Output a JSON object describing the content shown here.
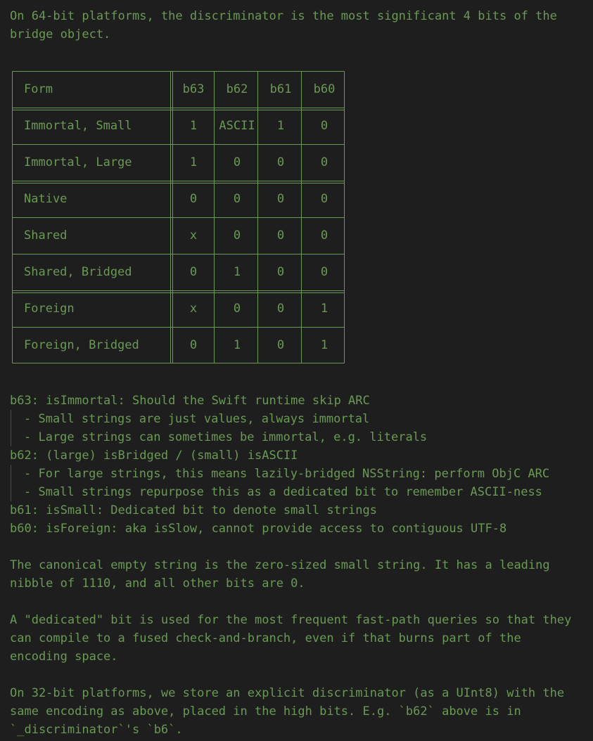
{
  "intro": {
    "line1": "On 64-bit platforms, the discriminator is the most significant 4 bits of the",
    "line2": "bridge object."
  },
  "table": {
    "headers": [
      "Form",
      "b63",
      "b62",
      "b61",
      "b60"
    ],
    "rows": [
      {
        "form": "Immortal, Small",
        "b63": "1",
        "b62": "ASCII",
        "b61": "1",
        "b60": "0"
      },
      {
        "form": "Immortal, Large",
        "b63": "1",
        "b62": "0",
        "b61": "0",
        "b60": "0"
      },
      {
        "form": "Native",
        "b63": "0",
        "b62": "0",
        "b61": "0",
        "b60": "0"
      },
      {
        "form": "Shared",
        "b63": "x",
        "b62": "0",
        "b61": "0",
        "b60": "0"
      },
      {
        "form": "Shared, Bridged",
        "b63": "0",
        "b62": "1",
        "b61": "0",
        "b60": "0"
      },
      {
        "form": "Foreign",
        "b63": "x",
        "b62": "0",
        "b61": "0",
        "b60": "1"
      },
      {
        "form": "Foreign, Bridged",
        "b63": "0",
        "b62": "1",
        "b61": "0",
        "b60": "1"
      }
    ]
  },
  "bits": {
    "b63": "b63: isImmortal: Should the Swift runtime skip ARC",
    "b63_items": [
      "- Small strings are just values, always immortal",
      "- Large strings can sometimes be immortal, e.g. literals"
    ],
    "b62": "b62: (large) isBridged / (small) isASCII",
    "b62_items": [
      "- For large strings, this means lazily-bridged NSString: perform ObjC ARC",
      "- Small strings repurpose this as a dedicated bit to remember ASCII-ness"
    ],
    "b61": "b61: isSmall: Dedicated bit to denote small strings",
    "b60": "b60: isForeign: aka isSlow, cannot provide access to contiguous UTF-8"
  },
  "para_empty": {
    "line1": "The canonical empty string is the zero-sized small string. It has a leading",
    "line2": "nibble of 1110, and all other bits are 0."
  },
  "para_dedicated": {
    "line1": "A \"dedicated\" bit is used for the most frequent fast-path queries so that they",
    "line2": "can compile to a fused check-and-branch, even if that burns part of the",
    "line3": "encoding space."
  },
  "para_32bit": {
    "line1": "On 32-bit platforms, we store an explicit discriminator (as a UInt8) with the",
    "line2": "same encoding as above, placed in the high bits. E.g. `b62` above is in",
    "line3": "`_discriminator`'s `b6`."
  },
  "colors": {
    "text": "#6a9955",
    "background": "#1e1e1e",
    "table_rule": "#6a9955",
    "guide": "#4a4a4a"
  }
}
